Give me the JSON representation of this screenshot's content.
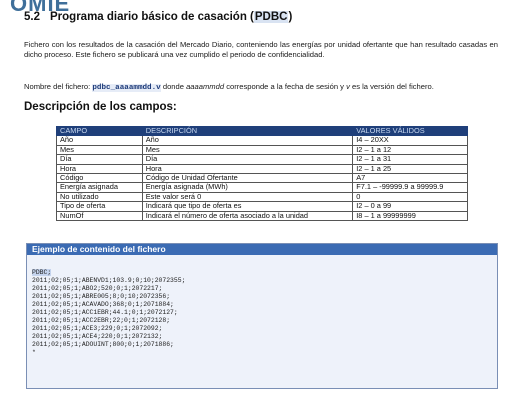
{
  "header_fragment": "OMIE",
  "section": {
    "number": "5.2",
    "title_prefix": "Programa diario básico de casación (",
    "title_highlight": "PDBC",
    "title_suffix": ")"
  },
  "intro": "Fichero con los resultados de la casación del Mercado Diario, conteniendo las energías por unidad ofertante que han resultado casadas en dicho proceso. Este fichero se publicará una vez cumplido el periodo de confidencialidad.",
  "filename_note": {
    "prefix": "Nombre del fichero: ",
    "filename": "pdbc_aaaammdd.v",
    "middle": " donde ",
    "date_var": "aaaammdd",
    "middle2": " corresponde a la fecha de sesión y ",
    "version_var": "v",
    "suffix": " es la versión del fichero."
  },
  "fields_title": "Descripción de los campos:",
  "fields_table": {
    "headers": [
      "CAMPO",
      "DESCRIPCIÓN",
      "VALORES VÁLIDOS"
    ],
    "rows": [
      [
        "Año",
        "Año",
        "I4 – 20XX"
      ],
      [
        "Mes",
        "Mes",
        "I2 – 1 a 12"
      ],
      [
        "Día",
        "Día",
        "I2 – 1 a 31"
      ],
      [
        "Hora",
        "Hora",
        "I2 – 1 a 25"
      ],
      [
        "Código",
        "Código de Unidad Ofertante",
        "A7"
      ],
      [
        "Energía asignada",
        "Energía asignada (MWh)",
        "F7.1 – -99999.9 a 99999.9"
      ],
      [
        "No utilizado",
        "Este valor será 0",
        "0"
      ],
      [
        "Tipo de oferta",
        "Indicará que tipo de oferta es",
        "I2 – 0 a 99"
      ],
      [
        "NumOf",
        "Indicará el número de oferta asociado a la unidad",
        "I8 –  1 a 99999999"
      ]
    ]
  },
  "example": {
    "title": "Ejemplo de contenido del fichero",
    "lines": [
      "PDBC;",
      "2011;02;05;1;ABENVD1;103.9;0;10;2072355;",
      "2011;02;05;1;ABO2;520;0;1;2072217;",
      "2011;02;05;1;ABRE005;8;0;10;2072356;",
      "2011;02;05;1;ACAVADO;368;0;1;2071884;",
      "2011;02;05;1;ACC1EBR;44.1;0;1;2072127;",
      "2011;02;05;1;ACC2EBR;22;0;1;2072128;",
      "2011;02;05;1;ACE3;229;0;1;2072092;",
      "2011;02;05;1;ACE4;220;0;1;2072132;",
      "2011;02;05;1;ADOUINT;800;0;1;2071886;",
      "*"
    ]
  },
  "colors": {
    "table_header_bg": "#1f3f7a",
    "example_header_bg": "#3b6bb3",
    "highlight": "#d9e3f2"
  }
}
